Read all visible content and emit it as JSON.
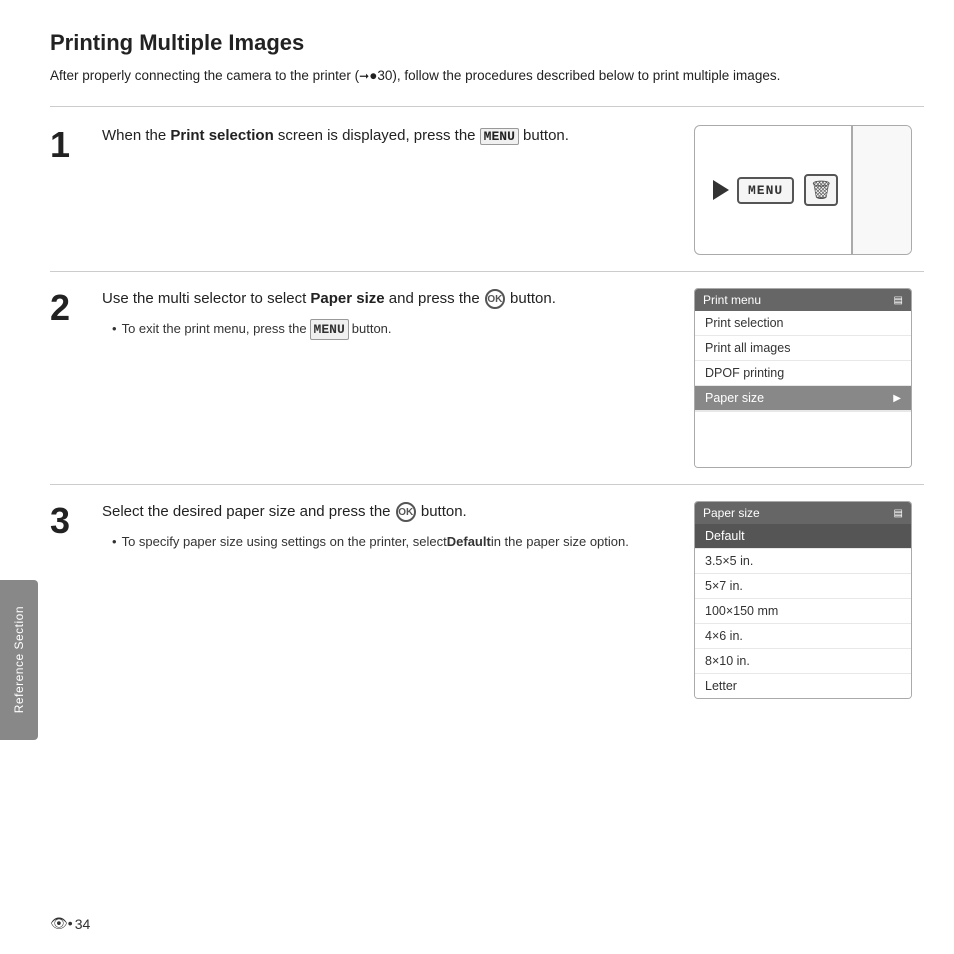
{
  "page": {
    "title": "Printing Multiple Images",
    "intro": "After properly connecting the camera to the printer (➘30), follow the procedures described below to print multiple images.",
    "side_tab": "Reference Section",
    "footer_page": "34"
  },
  "steps": [
    {
      "number": "1",
      "text_before": "When the ",
      "text_bold": "Print selection",
      "text_after": " screen is displayed, press the ",
      "text_end": " button.",
      "menu_label": "MENU",
      "bullets": []
    },
    {
      "number": "2",
      "text_before": "Use the multi selector to select ",
      "text_bold": "Paper size",
      "text_after": " and press the ",
      "text_end": " button.",
      "ok_label": "OK",
      "bullets": [
        "To exit the print menu, press the  button."
      ],
      "menu_label": "MENU",
      "print_menu": {
        "header": "Print menu",
        "items": [
          "Print selection",
          "Print all images",
          "DPOF printing",
          "Paper size"
        ]
      }
    },
    {
      "number": "3",
      "text_before": "Select the desired paper size and press the ",
      "text_end": " button.",
      "ok_label": "OK",
      "bullets": [
        "To specify paper size using settings on the printer, select Default in the paper size option."
      ],
      "bullet_bold": "Default",
      "paper_size": {
        "header": "Paper size",
        "items": [
          "Default",
          "3.5×5 in.",
          "5×7 in.",
          "100×150 mm",
          "4×6 in.",
          "8×10 in.",
          "Letter"
        ]
      }
    }
  ]
}
